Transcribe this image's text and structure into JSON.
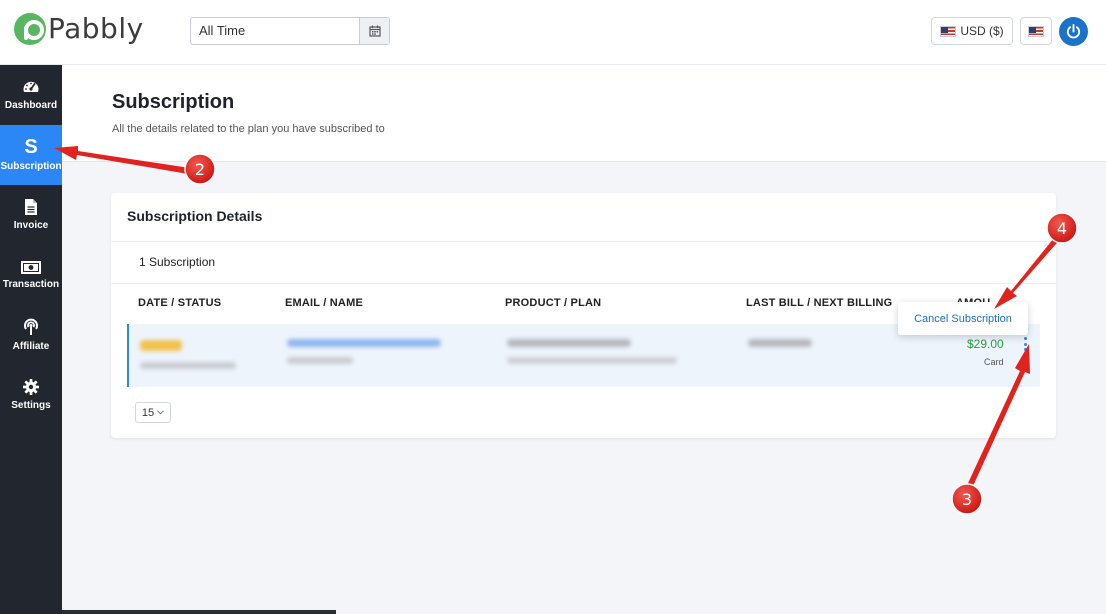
{
  "brand": {
    "name": "Pabbly"
  },
  "header": {
    "date_filter_value": "All Time",
    "currency_label": "USD ($)"
  },
  "sidebar": {
    "items": [
      {
        "label": "Dashboard",
        "icon": "dashboard-gauge-icon",
        "active": false
      },
      {
        "label": "Subscription",
        "icon": "dollar-s-icon",
        "active": true
      },
      {
        "label": "Invoice",
        "icon": "document-icon",
        "active": false
      },
      {
        "label": "Transaction",
        "icon": "cash-icon",
        "active": false
      },
      {
        "label": "Affiliate",
        "icon": "broadcast-icon",
        "active": false
      },
      {
        "label": "Settings",
        "icon": "gear-icon",
        "active": false
      }
    ]
  },
  "page": {
    "title": "Subscription",
    "subtitle": "All the details related to the plan you have subscribed to"
  },
  "details": {
    "card_title": "Subscription Details",
    "count_label": "1 Subscription",
    "columns": [
      "DATE / STATUS",
      "EMAIL / NAME",
      "PRODUCT / PLAN",
      "LAST BILL / NEXT BILLING",
      "AMOU"
    ],
    "row": {
      "amount": "$29.00",
      "payment_method": "Card"
    },
    "per_page": "15"
  },
  "menu": {
    "cancel_label": "Cancel Subscription"
  },
  "annotations": [
    {
      "number": "2"
    },
    {
      "number": "3"
    },
    {
      "number": "4"
    }
  ],
  "colors": {
    "accent": "#2b87f5",
    "sidebar_bg": "#22262e",
    "amount_green": "#2e9e45",
    "annotation_red": "#e0231f"
  }
}
